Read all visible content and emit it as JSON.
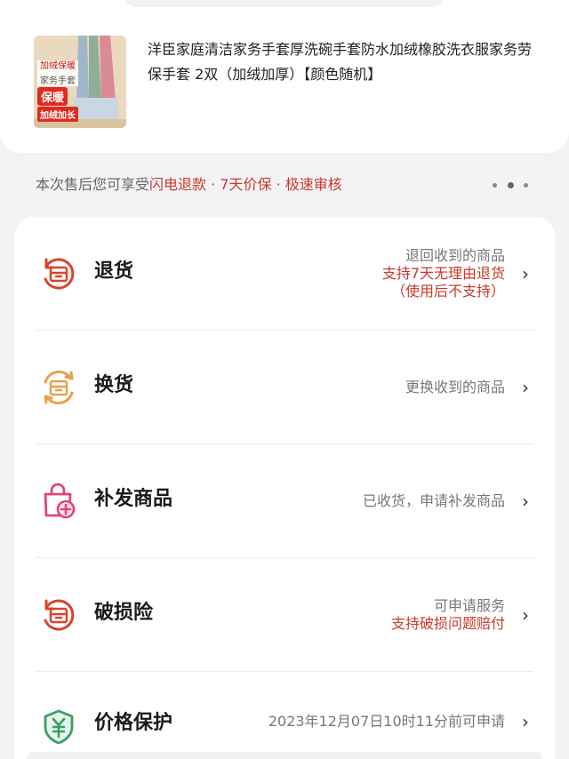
{
  "product": {
    "title": "洋臣家庭清洁家务手套厚洗碗手套防水加绒橡胶洗衣服家务劳保手套 2双（加绒加厚）【颜色随机】",
    "thumb_tags": [
      "加绒保暖",
      "家务手套",
      "保暖",
      "加绒加长"
    ]
  },
  "benefits": {
    "prefix": "本次售后您可享受",
    "highlight": "闪电退款 · 7天价保 · 极速审核"
  },
  "options": [
    {
      "id": "return",
      "label": "退货",
      "icon": "return-box-icon",
      "icon_color": "#d9432e",
      "lines": [
        {
          "text": "退回收到的商品",
          "style": "gray"
        },
        {
          "text": "支持7天无理由退货",
          "style": "red"
        },
        {
          "text": "（使用后不支持）",
          "style": "red"
        }
      ]
    },
    {
      "id": "exchange",
      "label": "换货",
      "icon": "exchange-box-icon",
      "icon_color": "#e8a04e",
      "lines": [
        {
          "text": "更换收到的商品",
          "style": "gray"
        }
      ]
    },
    {
      "id": "reissue",
      "label": "补发商品",
      "icon": "bag-plus-icon",
      "icon_color": "#e0457a",
      "lines": [
        {
          "text": "已收货，申请补发商品",
          "style": "gray"
        }
      ]
    },
    {
      "id": "damage",
      "label": "破损险",
      "icon": "damage-box-icon",
      "icon_color": "#d9432e",
      "lines": [
        {
          "text": "可申请服务",
          "style": "gray"
        },
        {
          "text": "支持破损问题赔付",
          "style": "red"
        }
      ]
    },
    {
      "id": "price",
      "label": "价格保护",
      "icon": "yuan-shield-icon",
      "icon_color": "#3aa064",
      "lines": [
        {
          "text": "2023年12月07日10时11分前可申请",
          "style": "gray"
        }
      ]
    }
  ],
  "chevron": "›",
  "colors": {
    "accent_red": "#c83a2a",
    "page_bg": "#f3f3f5",
    "card_bg": "#ffffff"
  }
}
